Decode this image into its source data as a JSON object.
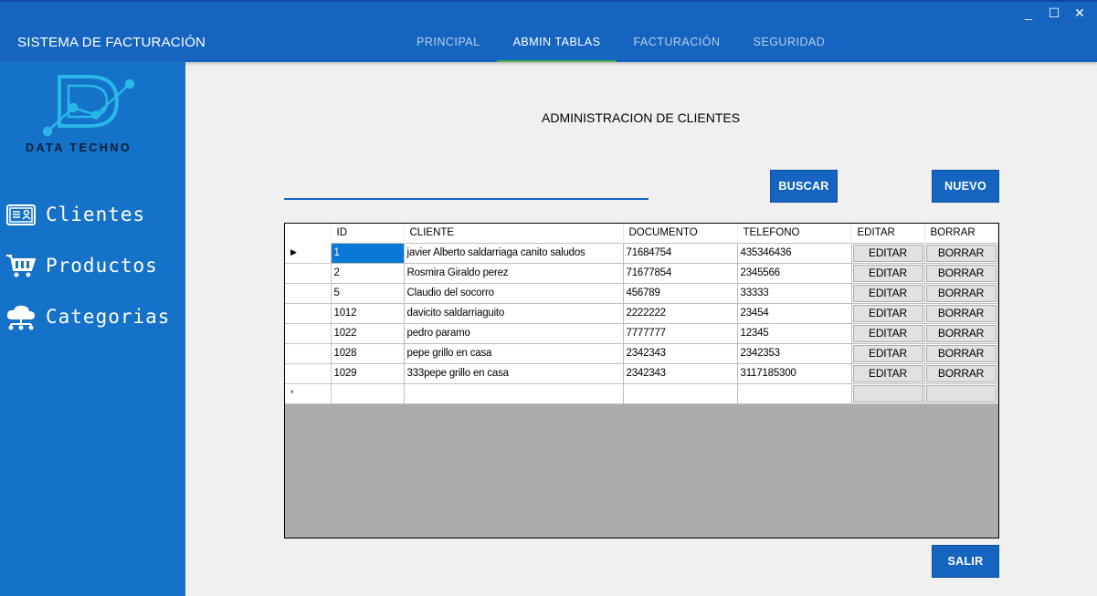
{
  "window": {
    "minimize": "_",
    "maximize": "☐",
    "close": "✕"
  },
  "app_title": "SISTEMA DE FACTURACIÓN",
  "tabs": [
    {
      "label": "PRINCIPAL"
    },
    {
      "label": "ABMIN TABLAS"
    },
    {
      "label": "FACTURACIÓN"
    },
    {
      "label": "SEGURIDAD"
    }
  ],
  "sidebar": {
    "logo_text": "DATA TECHNO",
    "items": [
      {
        "label": "Clientes",
        "icon": "id-card-icon"
      },
      {
        "label": "Productos",
        "icon": "cart-icon"
      },
      {
        "label": "Categorias",
        "icon": "cloud-network-icon"
      }
    ]
  },
  "main": {
    "heading": "ADMINISTRACION DE CLIENTES",
    "search_value": "",
    "buscar_label": "BUSCAR",
    "nuevo_label": "NUEVO",
    "salir_label": "SALIR"
  },
  "grid": {
    "columns": [
      "ID",
      "CLIENTE",
      "DOCUMENTO",
      "TELEFONO",
      "EDITAR",
      "BORRAR"
    ],
    "rows": [
      {
        "id": "1",
        "cliente": "javier Alberto saldarriaga canito saludos",
        "documento": "71684754",
        "telefono": "435346436",
        "editar": "EDITAR",
        "borrar": "BORRAR"
      },
      {
        "id": "2",
        "cliente": "Rosmira Giraldo perez",
        "documento": "71677854",
        "telefono": "2345566",
        "editar": "EDITAR",
        "borrar": "BORRAR"
      },
      {
        "id": "5",
        "cliente": "Claudio del socorro",
        "documento": "456789",
        "telefono": "33333",
        "editar": "EDITAR",
        "borrar": "BORRAR"
      },
      {
        "id": "1012",
        "cliente": "davicito saldarriaguito",
        "documento": "2222222",
        "telefono": "23454",
        "editar": "EDITAR",
        "borrar": "BORRAR"
      },
      {
        "id": "1022",
        "cliente": "pedro paramo",
        "documento": "7777777",
        "telefono": "12345",
        "editar": "EDITAR",
        "borrar": "BORRAR"
      },
      {
        "id": "1028",
        "cliente": "pepe grillo en casa",
        "documento": "2342343",
        "telefono": "2342353",
        "editar": "EDITAR",
        "borrar": "BORRAR"
      },
      {
        "id": "1029",
        "cliente": "333pepe grillo en casa",
        "documento": "2342343",
        "telefono": "3117185300",
        "editar": "EDITAR",
        "borrar": "BORRAR"
      }
    ],
    "current_row_marker": "▶",
    "new_row_marker": "*"
  },
  "colors": {
    "primary": "#1565c0",
    "sidebar": "#1572c9",
    "tab_underline": "#4caf50",
    "selection": "#0a78d4"
  }
}
